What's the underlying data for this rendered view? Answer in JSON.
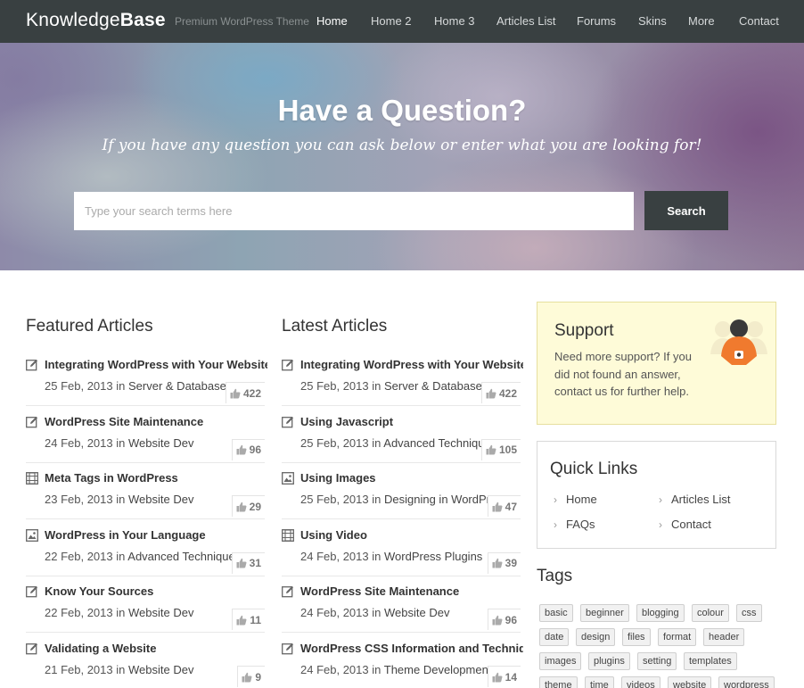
{
  "header": {
    "logo_regular": "Knowledge",
    "logo_bold": "Base",
    "tagline": "Premium WordPress Theme",
    "nav": [
      "Home",
      "Home 2",
      "Home 3",
      "Articles List",
      "Forums",
      "Skins",
      "More",
      "Contact"
    ],
    "active_nav": "Home"
  },
  "hero": {
    "title": "Have a Question?",
    "subtitle": "If you have any question you can ask below or enter what you are looking for!",
    "search_placeholder": "Type your search terms here",
    "search_value": "",
    "search_button": "Search"
  },
  "featured": {
    "title": "Featured Articles",
    "articles": [
      {
        "title": "Integrating WordPress with Your Website",
        "date": "25 Feb, 2013",
        "in": "in",
        "category": "Server & Database",
        "likes": "422",
        "icon": "edit-icon"
      },
      {
        "title": "WordPress Site Maintenance",
        "date": "24 Feb, 2013",
        "in": "in",
        "category": "Website Dev",
        "likes": "96",
        "icon": "edit-icon"
      },
      {
        "title": "Meta Tags in WordPress",
        "date": "23 Feb, 2013",
        "in": "in",
        "category": "Website Dev",
        "likes": "29",
        "icon": "video-icon"
      },
      {
        "title": "WordPress in Your Language",
        "date": "22 Feb, 2013",
        "in": "in",
        "category": "Advanced Techniques",
        "likes": "31",
        "icon": "image-icon"
      },
      {
        "title": "Know Your Sources",
        "date": "22 Feb, 2013",
        "in": "in",
        "category": "Website Dev",
        "likes": "11",
        "icon": "edit-icon"
      },
      {
        "title": "Validating a Website",
        "date": "21 Feb, 2013",
        "in": "in",
        "category": "Website Dev",
        "likes": "9",
        "icon": "edit-icon"
      }
    ]
  },
  "latest": {
    "title": "Latest Articles",
    "articles": [
      {
        "title": "Integrating WordPress with Your Website",
        "date": "25 Feb, 2013",
        "in": "in",
        "category": "Server & Database",
        "likes": "422",
        "icon": "edit-icon"
      },
      {
        "title": "Using Javascript",
        "date": "25 Feb, 2013",
        "in": "in",
        "category": "Advanced Techniques",
        "likes": "105",
        "icon": "edit-icon"
      },
      {
        "title": "Using Images",
        "date": "25 Feb, 2013",
        "in": "in",
        "category": "Designing in WordPress",
        "likes": "47",
        "icon": "image-icon"
      },
      {
        "title": "Using Video",
        "date": "24 Feb, 2013",
        "in": "in",
        "category": "WordPress Plugins",
        "likes": "39",
        "icon": "video-icon"
      },
      {
        "title": "WordPress Site Maintenance",
        "date": "24 Feb, 2013",
        "in": "in",
        "category": "Website Dev",
        "likes": "96",
        "icon": "edit-icon"
      },
      {
        "title": "WordPress CSS Information and Techniques",
        "date": "24 Feb, 2013",
        "in": "in",
        "category": "Theme Development",
        "likes": "14",
        "icon": "edit-icon"
      }
    ]
  },
  "support": {
    "title": "Support",
    "text": "Need more support? If you did not found an answer, contact us for further help."
  },
  "quick_links": {
    "title": "Quick Links",
    "items": [
      "Home",
      "Articles List",
      "FAQs",
      "Contact"
    ]
  },
  "tags": {
    "title": "Tags",
    "items": [
      "basic",
      "beginner",
      "blogging",
      "colour",
      "css",
      "date",
      "design",
      "files",
      "format",
      "header",
      "images",
      "plugins",
      "setting",
      "templates",
      "theme",
      "time",
      "videos",
      "website",
      "wordpress"
    ]
  },
  "colors": {
    "header_bg": "#394041",
    "support_bg": "#fefbd8",
    "support_accent": "#f07a2e"
  }
}
